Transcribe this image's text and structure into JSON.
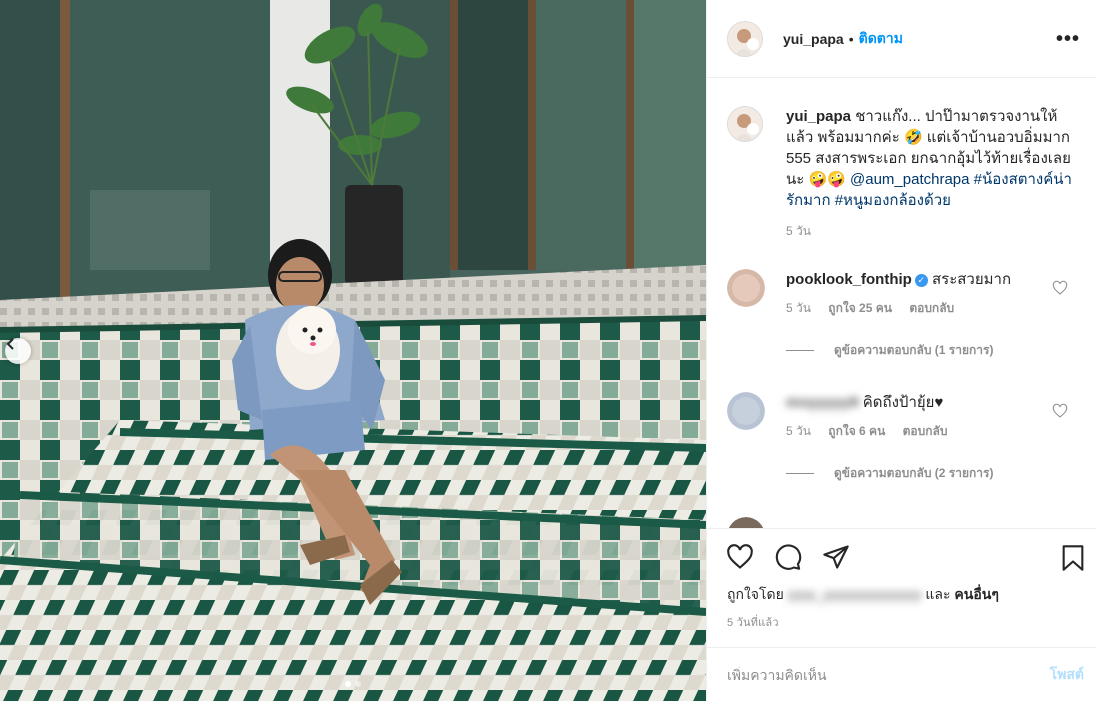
{
  "post": {
    "username": "yui_papa",
    "follow_label": "ติดตาม",
    "separator": "•",
    "more_label": "•••"
  },
  "caption": {
    "username": "yui_papa",
    "text": "ชาวแก๊ง... ปาป๊ามาตรวจงานให้แล้ว พร้อมมากค่ะ 🤣 แต่เจ้าบ้านอวบอิ่มมาก 555 สงสารพระเอก ยกฉากอุ้มไว้ท้ายเรื่องเลยนะ 🤪🤪",
    "mention": "@aum_patchrapa",
    "hashtags": "#น้องสตางค์น่ารักมาก #หนูมองกล้องด้วย",
    "age": "5 วัน"
  },
  "comments": [
    {
      "username": "pooklook_fonthip",
      "verified": true,
      "text": "สระสวยมาก",
      "age": "5 วัน",
      "likes": "ถูกใจ 25 คน",
      "reply_label": "ตอบกลับ",
      "view_replies": "ดูข้อความตอบกลับ (1 รายการ)"
    },
    {
      "username": "moyyyyy9",
      "text": "คิดถึงป้ายุ้ย♥",
      "age": "5 วัน",
      "likes": "ถูกใจ 6 คน",
      "reply_label": "ตอบกลับ",
      "view_replies": "ดูข้อความตอบกลับ (2 รายการ)"
    }
  ],
  "likes": {
    "prefix": "ถูกใจโดย",
    "blurred_users": "yyyy_yyyyyyyyyyyyyy",
    "suffix": "และ",
    "others": "คนอื่นๆ"
  },
  "timestamp": "5 วันที่แล้ว",
  "add_comment": {
    "placeholder": "เพิ่มความคิดเห็น",
    "post_label": "โพสต์"
  },
  "colors": {
    "accent": "#0095f6",
    "link": "#00376b",
    "muted": "#8e8e8e",
    "post_disabled": "#b2dffc"
  },
  "icons": [
    "chevron-left-icon",
    "heart-icon",
    "comment-icon",
    "share-icon",
    "bookmark-icon",
    "verified-icon"
  ],
  "carousel": {
    "slides": 2,
    "active": 1
  }
}
